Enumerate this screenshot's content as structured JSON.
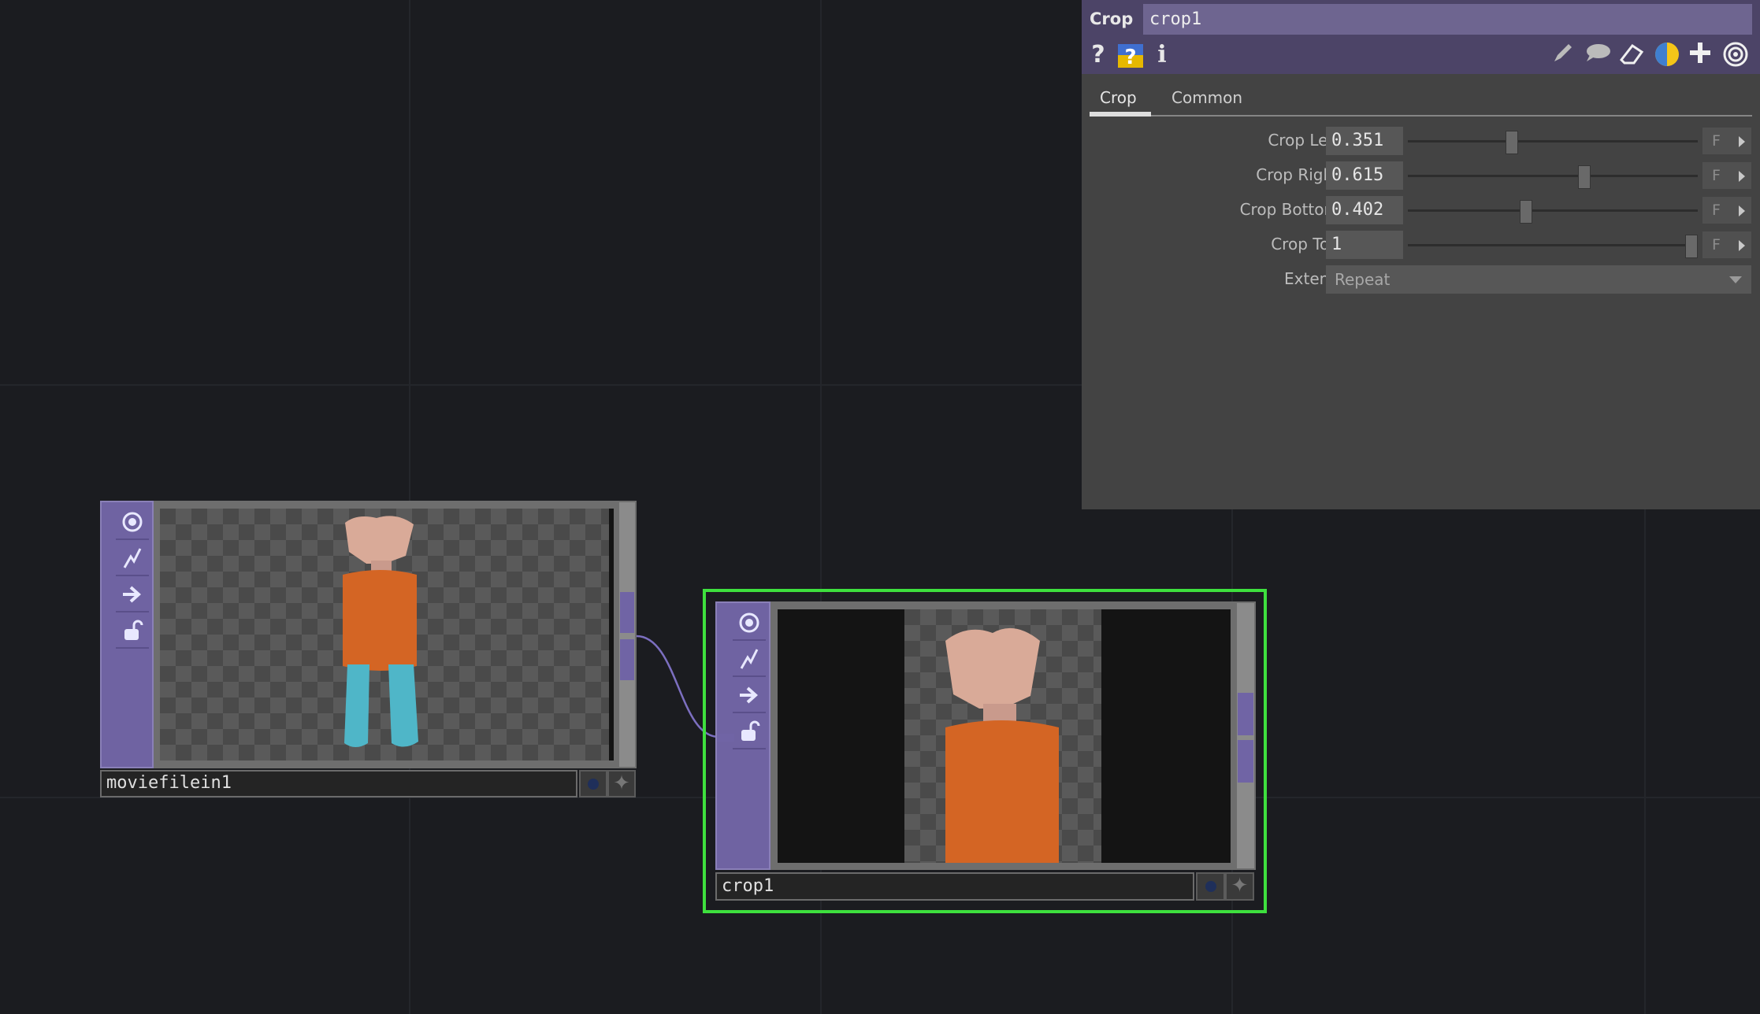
{
  "param_panel": {
    "op_type": "Crop",
    "op_name": "crop1",
    "header_icons": [
      "help-icon",
      "operator-help-icon",
      "info-icon",
      "pencil-icon",
      "comment-icon",
      "eraser-icon",
      "python-icon",
      "add-icon",
      "target-icon"
    ],
    "help_label": "?",
    "info_label": "i",
    "tabs": [
      {
        "label": "Crop",
        "active": true
      },
      {
        "label": "Common",
        "active": false
      }
    ],
    "params": [
      {
        "label": "Crop Left",
        "value": "0.351",
        "fraction": 0.351,
        "mode": "F"
      },
      {
        "label": "Crop Right",
        "value": "0.615",
        "fraction": 0.615,
        "mode": "F"
      },
      {
        "label": "Crop Bottom",
        "value": "0.402",
        "fraction": 0.402,
        "mode": "F"
      },
      {
        "label": "Crop Top",
        "value": "1",
        "fraction": 1.0,
        "mode": "F"
      }
    ],
    "extend": {
      "label": "Extend",
      "value": "Repeat"
    }
  },
  "nodes": {
    "moviefilein": {
      "name": "moviefilein1"
    },
    "crop": {
      "name": "crop1",
      "selected": true
    }
  },
  "colors": {
    "selection": "#3ee03e",
    "node_side": "#6f63a2",
    "panel_header": "#4c4467"
  }
}
